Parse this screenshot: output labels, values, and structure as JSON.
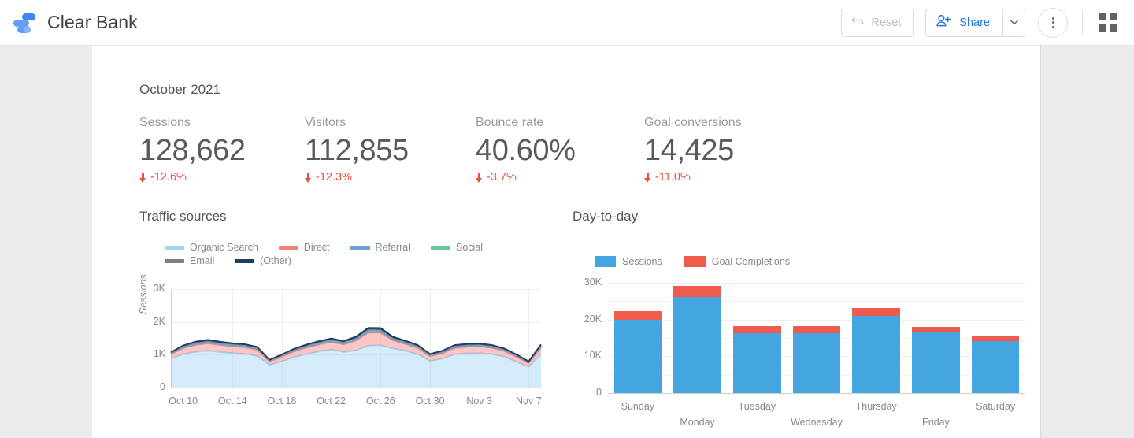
{
  "header": {
    "app_title": "Clear Bank",
    "logo_icon": "data-studio-logo-icon",
    "reset_label": "Reset",
    "reset_icon": "undo-arrow-icon",
    "share_label": "Share",
    "share_icon": "person-add-icon",
    "share_caret_icon": "chevron-down-icon",
    "more_icon": "more-vertical-icon",
    "grid_icon": "apps-grid-icon"
  },
  "report": {
    "month_label": "October 2021",
    "scorecards": [
      {
        "title": "Sessions",
        "value": "128,662",
        "delta": "-12.6%",
        "delta_icon": "arrow-down-icon",
        "delta_color": "#ea4f41"
      },
      {
        "title": "Visitors",
        "value": "112,855",
        "delta": "-12.3%",
        "delta_icon": "arrow-down-icon",
        "delta_color": "#ea4f41"
      },
      {
        "title": "Bounce rate",
        "value": "40.60%",
        "delta": "-3.7%",
        "delta_icon": "arrow-down-icon",
        "delta_color": "#ea4f41"
      },
      {
        "title": "Goal conversions",
        "value": "14,425",
        "delta": "-11.0%",
        "delta_icon": "arrow-down-icon",
        "delta_color": "#ea4f41"
      }
    ],
    "traffic_sources_title": "Traffic sources",
    "day_to_day_title": "Day-to-day"
  },
  "chart_data": [
    {
      "type": "area",
      "title": "Traffic sources",
      "stacked": true,
      "xlabel": "",
      "ylabel": "Sessions",
      "ylim": [
        0,
        3000
      ],
      "yticks": [
        "0",
        "1K",
        "2K",
        "3K"
      ],
      "ytick_values": [
        0,
        1000,
        2000,
        3000
      ],
      "xticks": [
        "Oct 10",
        "Oct 14",
        "Oct 18",
        "Oct 22",
        "Oct 26",
        "Oct 30",
        "Nov 3",
        "Nov 7"
      ],
      "grid": true,
      "legend_position": "top",
      "legend": [
        "Organic Search",
        "Direct",
        "Referral",
        "Social",
        "Email",
        "(Other)"
      ],
      "colors": {
        "Organic Search": "#9fd5f5",
        "Direct": "#f4837c",
        "Referral": "#6f9fd8",
        "Social": "#67c5a0",
        "Email": "#7f7f7f",
        "(Other)": "#1d3f66"
      },
      "x": [
        "Oct 9",
        "Oct 10",
        "Oct 11",
        "Oct 12",
        "Oct 13",
        "Oct 14",
        "Oct 15",
        "Oct 16",
        "Oct 17",
        "Oct 18",
        "Oct 19",
        "Oct 20",
        "Oct 21",
        "Oct 22",
        "Oct 23",
        "Oct 24",
        "Oct 25",
        "Oct 26",
        "Oct 27",
        "Oct 28",
        "Oct 29",
        "Oct 30",
        "Oct 31",
        "Nov 1",
        "Nov 2",
        "Nov 3",
        "Nov 4",
        "Nov 5",
        "Nov 6",
        "Nov 7",
        "Nov 8"
      ],
      "series": [
        {
          "name": "Organic Search",
          "values": [
            880,
            1020,
            1090,
            1120,
            1080,
            1050,
            1030,
            960,
            690,
            800,
            930,
            1020,
            1100,
            1160,
            1080,
            1130,
            1280,
            1290,
            1190,
            1120,
            1020,
            810,
            880,
            1010,
            1040,
            1050,
            1020,
            940,
            790,
            630,
            1020
          ]
        },
        {
          "name": "Direct",
          "values": [
            130,
            180,
            210,
            230,
            215,
            205,
            200,
            190,
            105,
            140,
            175,
            200,
            215,
            230,
            235,
            300,
            395,
            385,
            245,
            210,
            190,
            145,
            165,
            195,
            200,
            200,
            190,
            175,
            150,
            115,
            200
          ]
        },
        {
          "name": "Referral",
          "values": [
            35,
            45,
            52,
            55,
            52,
            50,
            48,
            45,
            27,
            35,
            42,
            48,
            52,
            55,
            55,
            62,
            75,
            72,
            58,
            50,
            46,
            35,
            40,
            47,
            48,
            48,
            46,
            42,
            36,
            28,
            48
          ]
        },
        {
          "name": "Social",
          "values": [
            8,
            10,
            12,
            12,
            12,
            11,
            11,
            10,
            6,
            8,
            9,
            11,
            12,
            12,
            12,
            14,
            17,
            16,
            13,
            11,
            10,
            8,
            9,
            11,
            11,
            11,
            10,
            9,
            8,
            6,
            11
          ]
        },
        {
          "name": "Email",
          "values": [
            5,
            6,
            7,
            7,
            7,
            7,
            6,
            6,
            4,
            5,
            6,
            6,
            7,
            7,
            7,
            8,
            10,
            9,
            8,
            7,
            6,
            5,
            5,
            6,
            6,
            6,
            6,
            5,
            5,
            4,
            6
          ]
        },
        {
          "name": "(Other)",
          "values": [
            20,
            26,
            30,
            32,
            30,
            29,
            28,
            26,
            16,
            20,
            24,
            28,
            30,
            32,
            32,
            36,
            44,
            42,
            34,
            29,
            27,
            20,
            23,
            27,
            28,
            28,
            27,
            24,
            21,
            16,
            28
          ]
        }
      ]
    },
    {
      "type": "bar",
      "title": "Day-to-day",
      "stacked": true,
      "xlabel": "",
      "ylabel": "",
      "ylim": [
        0,
        30000
      ],
      "yticks": [
        "0",
        "10K",
        "20K",
        "30K"
      ],
      "ytick_values": [
        0,
        10000,
        20000,
        30000
      ],
      "grid": true,
      "legend_position": "top",
      "legend": [
        "Sessions",
        "Goal Completions"
      ],
      "colors": {
        "Sessions": "#45a5e0",
        "Goal Completions": "#ef5b4c"
      },
      "categories": [
        "Sunday",
        "Monday",
        "Tuesday",
        "Wednesday",
        "Thursday",
        "Friday",
        "Saturday"
      ],
      "series": [
        {
          "name": "Sessions",
          "values": [
            20000,
            26200,
            16300,
            16200,
            21000,
            16600,
            14200
          ]
        },
        {
          "name": "Goal Completions",
          "values": [
            2300,
            2900,
            1900,
            2000,
            2200,
            1500,
            1300
          ]
        }
      ]
    }
  ]
}
